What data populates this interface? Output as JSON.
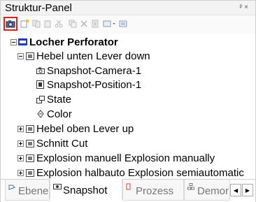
{
  "panel": {
    "title": "Struktur-Panel"
  },
  "toolbar": {
    "buttons": [
      {
        "icon": "camera-snapshot-icon"
      },
      {
        "icon": "new-item-icon"
      },
      {
        "icon": "copy-icon"
      },
      {
        "icon": "paste-icon"
      },
      {
        "icon": "cut-icon"
      },
      {
        "icon": "duplicate-icon"
      },
      {
        "icon": "delete-icon"
      },
      {
        "icon": "properties-icon"
      },
      {
        "icon": "view-options-icon"
      },
      {
        "icon": "list-icon"
      }
    ]
  },
  "tree": {
    "root": {
      "label": "Locher Perforator",
      "icon": "model-icon"
    },
    "items": [
      {
        "label": "Hebel unten Lever down",
        "icon": "snapshot-folder-icon",
        "expanded": true
      },
      {
        "label": "Snapshot-Camera-1",
        "icon": "camera-icon"
      },
      {
        "label": "Snapshot-Position-1",
        "icon": "position-icon"
      },
      {
        "label": "State",
        "icon": "state-icon"
      },
      {
        "label": "Color",
        "icon": "color-icon"
      },
      {
        "label": "Hebel oben Lever up",
        "icon": "snapshot-folder-icon",
        "expanded": false
      },
      {
        "label": "Schnitt Cut",
        "icon": "snapshot-folder-icon",
        "expanded": false
      },
      {
        "label": "Explosion manuell Explosion manually",
        "icon": "snapshot-folder-icon",
        "expanded": false
      },
      {
        "label": "Explosion halbauto Explosion semiautomatic",
        "icon": "snapshot-folder-icon",
        "expanded": false
      }
    ]
  },
  "tabs": [
    {
      "label": "Ebene",
      "icon": "layer-icon",
      "active": false
    },
    {
      "label": "Snapshot",
      "icon": "snapshot-icon",
      "active": true
    },
    {
      "label": "Prozess",
      "icon": "process-icon",
      "active": false
    },
    {
      "label": "Demor",
      "icon": "demo-icon",
      "active": false
    }
  ],
  "colors": {
    "selection_border": "#d6221f",
    "model_icon": "#1f3fb0"
  }
}
